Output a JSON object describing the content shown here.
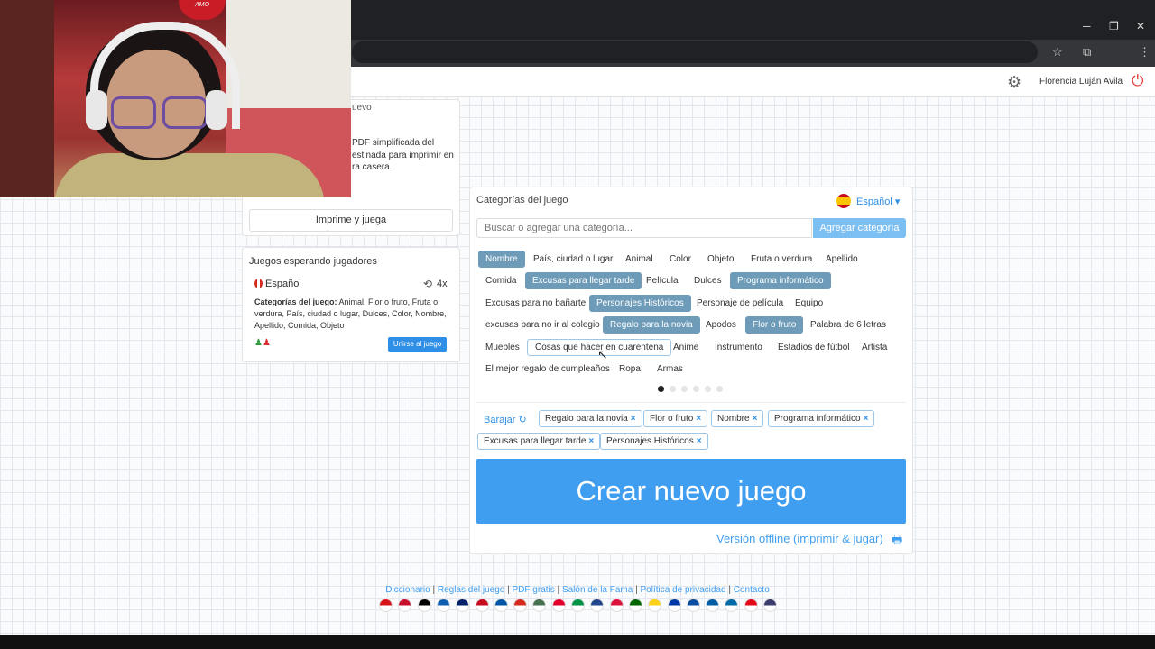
{
  "browser": {
    "minimize": "─",
    "maximize": "❐",
    "close": "✕",
    "star_icon": "☆",
    "ext_icon": "⧉",
    "menu_icon": "⋮"
  },
  "header": {
    "user_name": "Florencia Luján Avila",
    "settings_icon": "⚙",
    "logout_icon": "⏻"
  },
  "webcam": {
    "balloon_text": "AMO"
  },
  "left": {
    "frag_top": "uevo",
    "pdf_desc": [
      "PDF simplificada del",
      "estinada para imprimir en",
      "ra casera."
    ],
    "print_button": "Imprime y juega",
    "waiting": {
      "title": "Juegos esperando jugadores",
      "language": "Español",
      "multiplier": "4x",
      "categories_label": "Categorías del juego:",
      "categories": "Animal, Flor o fruto, Fruta o verdura, País, ciudad o lugar, Dulces, Color, Nombre, Apellido, Comida, Objeto",
      "join_button": "Unirse al juego"
    }
  },
  "main": {
    "title": "Categorías del juego",
    "language": "Español",
    "search_placeholder": "Buscar o agregar una categoría...",
    "add_button": "Agregar categoría",
    "tags": [
      "Nombre",
      "País, ciudad o lugar",
      "Animal",
      "Color",
      "Objeto",
      "Fruta o verdura",
      "Apellido",
      "Comida",
      "Excusas para llegar tarde",
      "Película",
      "Dulces",
      "Programa informático",
      "Excusas para no bañarte",
      "Personajes Históricos",
      "Personaje de película",
      "Equipo",
      "excusas para no ir al colegio",
      "Regalo para la novia",
      "Apodos",
      "Flor o fruto",
      "Palabra de 6 letras",
      "Muebles",
      "Cosas que hacer en cuarentena",
      "Anime",
      "Instrumento",
      "Estadios de fútbol",
      "Artista",
      "El mejor regalo de cumpleaños",
      "Ropa",
      "Armas"
    ],
    "selected_tags": [
      "Nombre",
      "Excusas para llegar tarde",
      "Programa informático",
      "Personajes Históricos",
      "Regalo para la novia",
      "Flor o fruto"
    ],
    "pager_pages": 6,
    "pager_current": 1,
    "shuffle_label": "Barajar",
    "shuffle_icon": "↻",
    "chips": [
      "Regalo para la novia",
      "Flor o fruto",
      "Nombre",
      "Programa informático",
      "Excusas para llegar tarde",
      "Personajes Históricos"
    ],
    "chip_remove": "×",
    "create_button": "Crear nuevo juego",
    "offline_link": "Versión offline (imprimir & jugar)",
    "offline_icon": "🖶"
  },
  "footer": {
    "links": [
      "Diccionario",
      "Reglas del juego",
      "PDF gratis",
      "Salón de la Fama",
      "Política de privacidad",
      "Contacto"
    ],
    "separator": "|",
    "flag_colors": [
      "#d7141a",
      "#c8102e",
      "#000000",
      "#0d5eaf",
      "#012169",
      "#c60b1e",
      "#0055a4",
      "#d52b1e",
      "#477050",
      "#e4002b",
      "#009246",
      "#21468b",
      "#dc143c",
      "#006600",
      "#fcd116",
      "#0039a6",
      "#0b4ea2",
      "#005da4",
      "#006aa7",
      "#e30a17",
      "#3c3b6e"
    ]
  }
}
